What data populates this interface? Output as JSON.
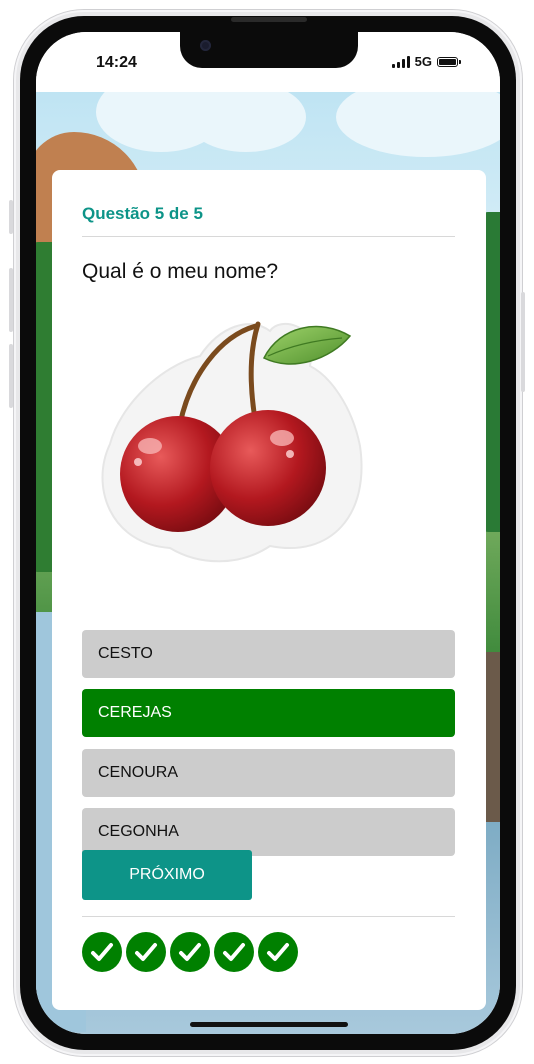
{
  "status_bar": {
    "time": "14:24",
    "network": "5G"
  },
  "quiz": {
    "counter": "Questão 5 de 5",
    "question": "Qual é o meu nome?",
    "image_subject": "cherries",
    "options": [
      {
        "label": "CESTO",
        "selected": false
      },
      {
        "label": "CEREJAS",
        "selected": true
      },
      {
        "label": "CENOURA",
        "selected": false
      },
      {
        "label": "CEGONHA",
        "selected": false
      }
    ],
    "next_label": "PRÓXIMO",
    "progress": {
      "answered_correct": 5,
      "total": 5
    }
  },
  "colors": {
    "accent": "#0d9488",
    "selected_option": "#008000",
    "option_default": "#cccccc",
    "progress_check": "#008000"
  },
  "icons": [
    "signal-icon",
    "battery-icon",
    "check-icon"
  ]
}
